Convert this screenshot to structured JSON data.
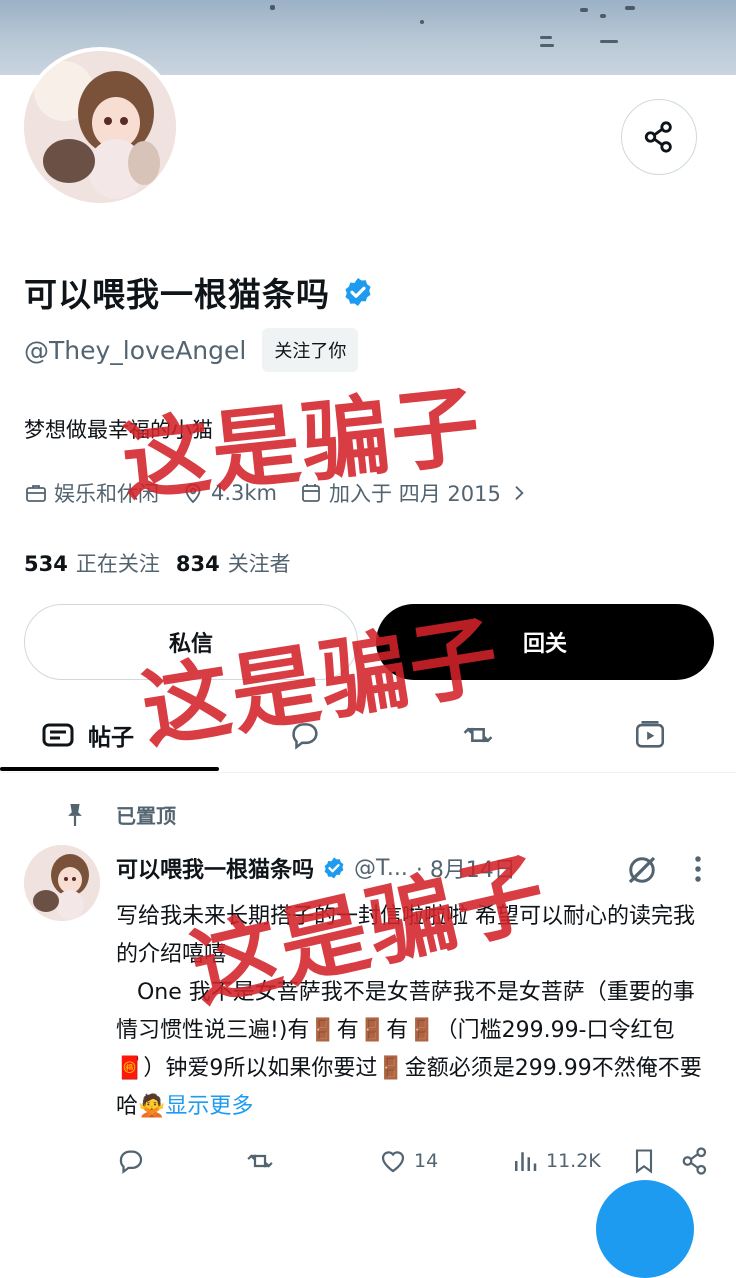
{
  "profile": {
    "display_name": "可以喂我一根猫条吗",
    "handle": "@They_loveAngel",
    "follows_you": "关注了你",
    "bio": "梦想做最幸福的小猫",
    "category": "娱乐和休闲",
    "location": "4.3km",
    "joined": "加入于 四月 2015",
    "following_count": "534",
    "following_label": "正在关注",
    "followers_count": "834",
    "followers_label": "关注者"
  },
  "buttons": {
    "message": "私信",
    "follow_back": "回关"
  },
  "tabs": [
    {
      "label": "帖子"
    }
  ],
  "pinned_label": "已置顶",
  "tweet": {
    "name": "可以喂我一根猫条吗",
    "handle": "@T...",
    "date": "· 8月14日",
    "body": "写给我未来长期搭子的一封信啦啦啦 希望可以耐心的读完我的介绍嘻嘻\n   One 我不是女菩萨我不是女菩萨我不是女菩萨（重要的事情习惯性说三遍!)有🚪有🚪有🚪（门槛299.99-口令红包🧧）钟爱9所以如果你要过🚪金额必须是299.99不然俺不要哈🙅",
    "show_more": "显示更多",
    "likes": "14",
    "views": "11.2K"
  },
  "watermark": "这是骗子",
  "colors": {
    "accent": "#1d9bf0",
    "stamp": "#d2232a",
    "text": "#0f1419",
    "muted": "#536471"
  }
}
